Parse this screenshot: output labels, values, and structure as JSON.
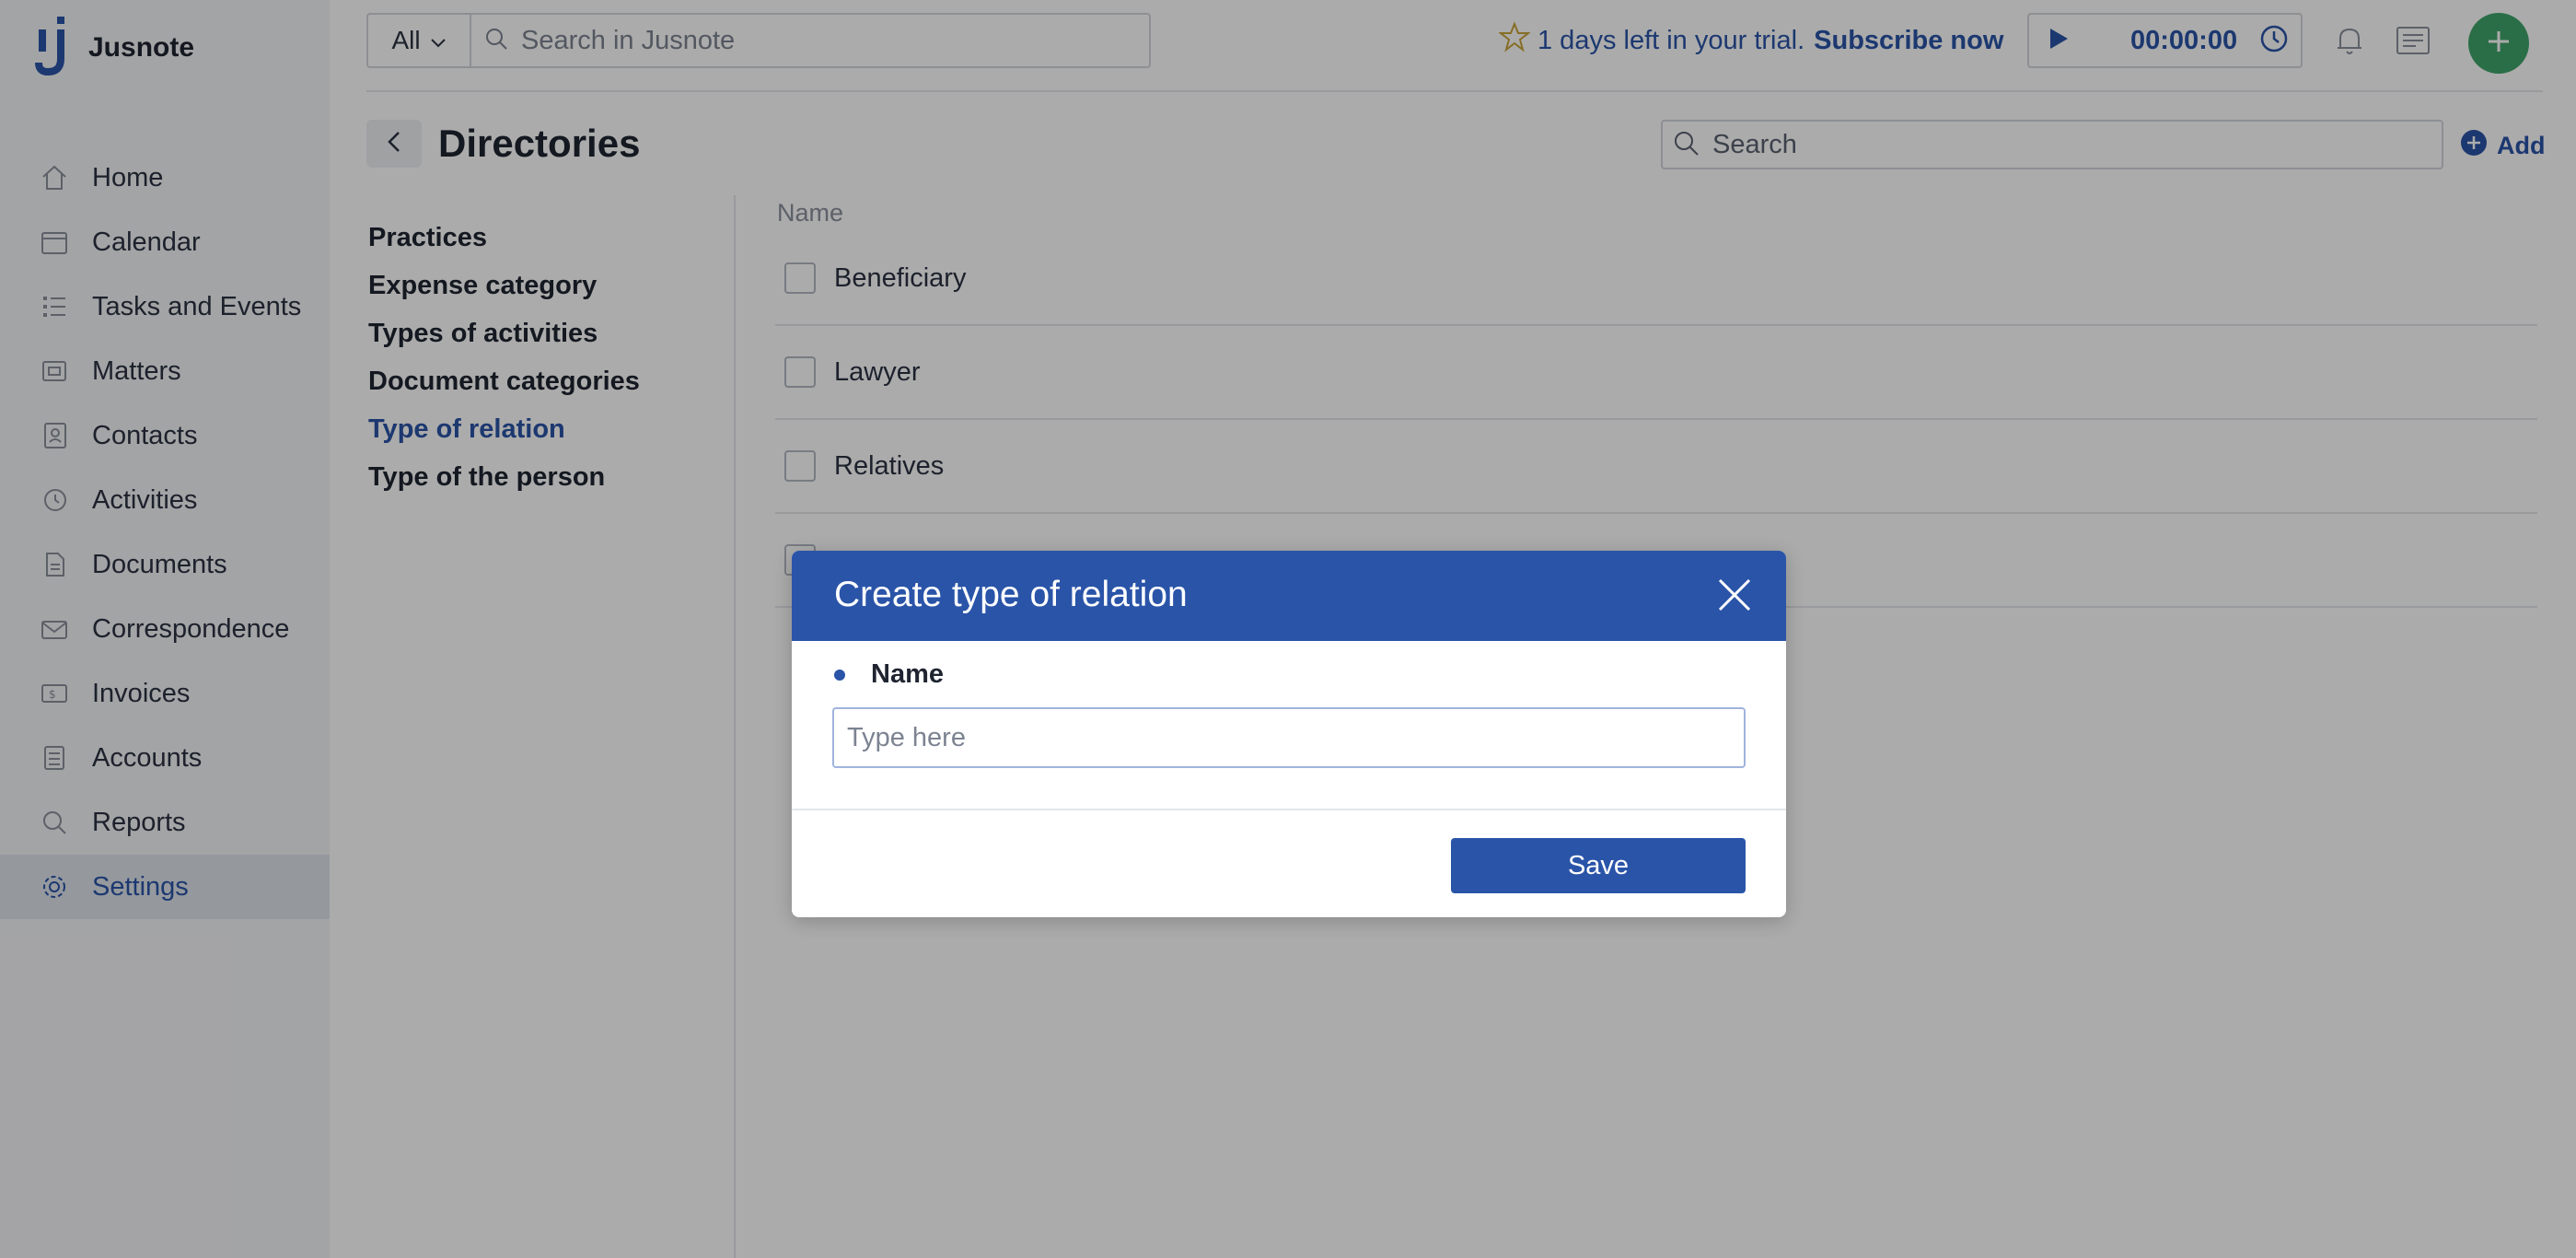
{
  "app": {
    "name": "Jusnote"
  },
  "sidebar": {
    "items": [
      {
        "label": "Home",
        "icon": "home-icon"
      },
      {
        "label": "Calendar",
        "icon": "calendar-icon"
      },
      {
        "label": "Tasks and Events",
        "icon": "tasks-icon"
      },
      {
        "label": "Matters",
        "icon": "matters-icon"
      },
      {
        "label": "Contacts",
        "icon": "contacts-icon"
      },
      {
        "label": "Activities",
        "icon": "activities-icon"
      },
      {
        "label": "Documents",
        "icon": "documents-icon"
      },
      {
        "label": "Correspondence",
        "icon": "correspondence-icon"
      },
      {
        "label": "Invoices",
        "icon": "invoices-icon"
      },
      {
        "label": "Accounts",
        "icon": "accounts-icon"
      },
      {
        "label": "Reports",
        "icon": "reports-icon"
      },
      {
        "label": "Settings",
        "icon": "gear-icon",
        "active": true
      }
    ]
  },
  "topbar": {
    "scope": "All",
    "search_placeholder": "Search in Jusnote",
    "trial_text": "1 days left in your trial.",
    "subscribe_label": "Subscribe now",
    "timer": "00:00:00"
  },
  "page": {
    "title": "Directories",
    "search_placeholder": "Search",
    "add_label": "Add"
  },
  "directory_nav": [
    {
      "label": "Practices"
    },
    {
      "label": "Expense category"
    },
    {
      "label": "Types of activities"
    },
    {
      "label": "Document categories"
    },
    {
      "label": "Type of relation",
      "active": true
    },
    {
      "label": "Type of the person"
    }
  ],
  "table": {
    "column": "Name",
    "rows": [
      "Beneficiary",
      "Lawyer",
      "Relatives",
      ""
    ]
  },
  "modal": {
    "title": "Create type of relation",
    "field_label": "Name",
    "placeholder": "Type here",
    "save_label": "Save"
  },
  "colors": {
    "primary": "#2a54a8",
    "accent_green": "#3fa56a",
    "sidebar_bg": "#f4f5f7",
    "active_nav_bg": "#dfe4ec"
  }
}
